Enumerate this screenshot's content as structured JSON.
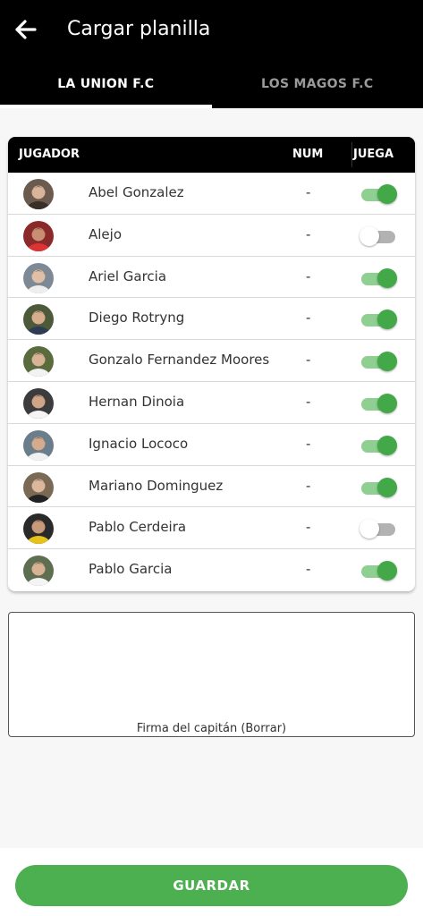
{
  "header": {
    "title": "Cargar planilla",
    "back_icon": "arrow-left-icon"
  },
  "tabs": [
    {
      "label": "LA UNION F.C",
      "active": true
    },
    {
      "label": "LOS MAGOS F.C",
      "active": false
    }
  ],
  "table": {
    "headers": {
      "player": "JUGADOR",
      "number": "NUM",
      "plays": "JUEGA"
    },
    "rows": [
      {
        "name": "Abel Gonzalez",
        "number": "-",
        "plays": true
      },
      {
        "name": "Alejo",
        "number": "-",
        "plays": false
      },
      {
        "name": "Ariel Garcia",
        "number": "-",
        "plays": true
      },
      {
        "name": "Diego Rotryng",
        "number": "-",
        "plays": true
      },
      {
        "name": "Gonzalo Fernandez Moores",
        "number": "-",
        "plays": true
      },
      {
        "name": "Hernan Dinoia",
        "number": "-",
        "plays": true
      },
      {
        "name": "Ignacio Lococo",
        "number": "-",
        "plays": true
      },
      {
        "name": "Mariano Dominguez",
        "number": "-",
        "plays": true
      },
      {
        "name": "Pablo Cerdeira",
        "number": "-",
        "plays": false
      },
      {
        "name": "Pablo Garcia",
        "number": "-",
        "plays": true
      }
    ]
  },
  "signature": {
    "label": "Firma del capitán (Borrar)"
  },
  "actions": {
    "save_label": "GUARDAR"
  },
  "colors": {
    "header_bg": "#000000",
    "accent_green": "#4caf50",
    "toggle_on_knob": "#43a847",
    "toggle_on_track": "#8fcf91",
    "toggle_off_track": "#b2b2b2"
  }
}
